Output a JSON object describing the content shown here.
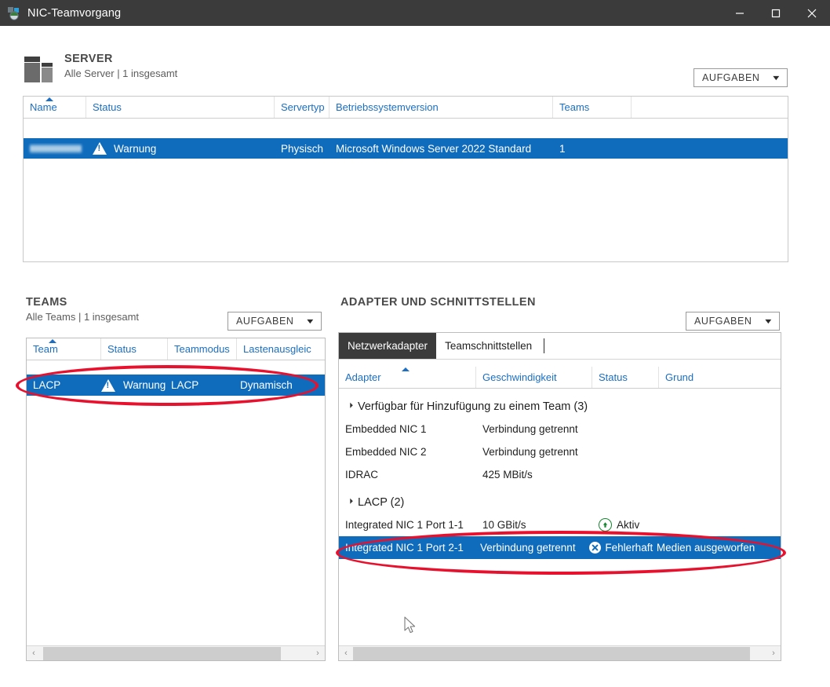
{
  "window": {
    "title": "NIC-Teamvorgang",
    "icon": "nic-teaming-icon",
    "minimize_label": "─",
    "maximize_label": "□",
    "close_label": "✕"
  },
  "server_section": {
    "title": "SERVER",
    "subtitle": "Alle Server | 1 insgesamt",
    "tasks_label": "AUFGABEN",
    "columns": [
      "Name",
      "Status",
      "Servertyp",
      "Betriebssystemversion",
      "Teams"
    ],
    "sorted_column": "Name",
    "rows": [
      {
        "name": "",
        "name_redacted": true,
        "status_icon": "warning-icon",
        "status": "Warnung",
        "servertyp": "Physisch",
        "os_version": "Microsoft Windows Server 2022 Standard",
        "teams": "1",
        "selected": true
      }
    ]
  },
  "teams_section": {
    "title": "TEAMS",
    "subtitle": "Alle Teams | 1 insgesamt",
    "tasks_label": "AUFGABEN",
    "columns": [
      "Team",
      "Status",
      "Teammodus",
      "Lastenausgleic"
    ],
    "sorted_column": "Team",
    "rows": [
      {
        "team": "LACP",
        "status_icon": "warning-icon",
        "status": "Warnung",
        "teammodus": "LACP",
        "lastenausgleich": "Dynamisch",
        "selected": true,
        "annotated": true
      }
    ],
    "scrollbar": {
      "left_arrow": "‹",
      "right_arrow": "›",
      "thumb_start_pct": 3,
      "thumb_width_pct": 76
    }
  },
  "adapters_section": {
    "title": "ADAPTER UND SCHNITTSTELLEN",
    "tasks_label": "AUFGABEN",
    "tabs": [
      {
        "label": "Netzwerkadapter",
        "active": true
      },
      {
        "label": "Teamschnittstellen",
        "active": false
      }
    ],
    "columns": [
      "Adapter",
      "Geschwindigkeit",
      "Status",
      "Grund"
    ],
    "sorted_column": "Adapter",
    "groups": [
      {
        "label": "Verfügbar für Hinzufügung zu einem Team (3)",
        "expanded": true,
        "rows": [
          {
            "adapter": "Embedded NIC 1",
            "speed": "Verbindung getrennt",
            "status": "",
            "status_icon": "",
            "reason": "",
            "selected": false
          },
          {
            "adapter": "Embedded NIC 2",
            "speed": "Verbindung getrennt",
            "status": "",
            "status_icon": "",
            "reason": "",
            "selected": false
          },
          {
            "adapter": "IDRAC",
            "speed": "425 MBit/s",
            "status": "",
            "status_icon": "",
            "reason": "",
            "selected": false
          }
        ]
      },
      {
        "label": "LACP (2)",
        "expanded": true,
        "rows": [
          {
            "adapter": "Integrated NIC 1 Port 1-1",
            "speed": "10 GBit/s",
            "status": "Aktiv",
            "status_icon": "active-up-arrow-icon",
            "reason": "",
            "selected": false
          },
          {
            "adapter": "Integrated NIC 1 Port 2-1",
            "speed": "Verbindung getrennt",
            "status": "Fehlerhaft",
            "status_icon": "fault-x-icon",
            "reason": "Medien ausgeworfen",
            "selected": true,
            "annotated": true
          }
        ]
      }
    ],
    "scrollbar": {
      "left_arrow": "‹",
      "right_arrow": "›",
      "thumb_start_pct": 2,
      "thumb_width_pct": 93
    }
  },
  "colors": {
    "titlebar": "#3b3b3b",
    "selection_blue": "#0f6cbd",
    "header_link_blue": "#1b6ec2",
    "annotation_red": "#e8112d",
    "active_green": "#13862f"
  }
}
